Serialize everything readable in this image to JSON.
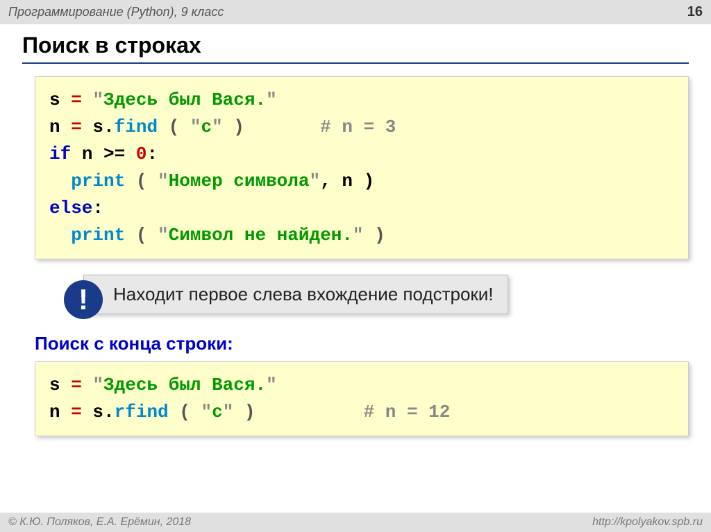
{
  "header": {
    "subject": "Программирование (Python), 9 класс",
    "page": "16"
  },
  "title": "Поиск в строках",
  "code1": {
    "l1_var": "s",
    "l1_eq": " = ",
    "l1_strq1": "\"",
    "l1_str": "Здесь был Вася.",
    "l1_strq2": "\"",
    "l2_var": "n",
    "l2_eq": " = ",
    "l2_obj": "s.",
    "l2_fn": "find",
    "l2_p1": " ( ",
    "l2_argq1": "\"",
    "l2_arg": "с",
    "l2_argq2": "\"",
    "l2_p2": " )",
    "l2_pad": "       ",
    "l2_cmt": "# n = 3",
    "l3_kw": "if",
    "l3_cond": " n >= ",
    "l3_num": "0",
    "l3_colon": ":",
    "l4_pad": "  ",
    "l4_fn": "print",
    "l4_p1": " ( ",
    "l4_q1": "\"",
    "l4_str": "Номер символа",
    "l4_q2": "\"",
    "l4_rest": ", n )",
    "l5_kw": "else",
    "l5_colon": ":",
    "l6_pad": "  ",
    "l6_fn": "print",
    "l6_p1": " ( ",
    "l6_q1": "\"",
    "l6_str": "Символ не найден.",
    "l6_q2": "\"",
    "l6_p2": " )"
  },
  "callout": {
    "badge": "!",
    "text": "Находит первое слева вхождение подстроки!"
  },
  "subheading": "Поиск с конца строки:",
  "code2": {
    "l1_var": "s",
    "l1_eq": " = ",
    "l1_q1": "\"",
    "l1_str": "Здесь был Вася.",
    "l1_q2": "\"",
    "l2_var": "n",
    "l2_eq": " = ",
    "l2_obj": "s.",
    "l2_fn": "rfind",
    "l2_p1": " ( ",
    "l2_q1": "\"",
    "l2_arg": "с",
    "l2_q2": "\"",
    "l2_p2": " )",
    "l2_pad": "          ",
    "l2_cmt": "# n = 12"
  },
  "footer": {
    "left": "© К.Ю. Поляков, Е.А. Ерёмин, 2018",
    "right": "http://kpolyakov.spb.ru"
  }
}
